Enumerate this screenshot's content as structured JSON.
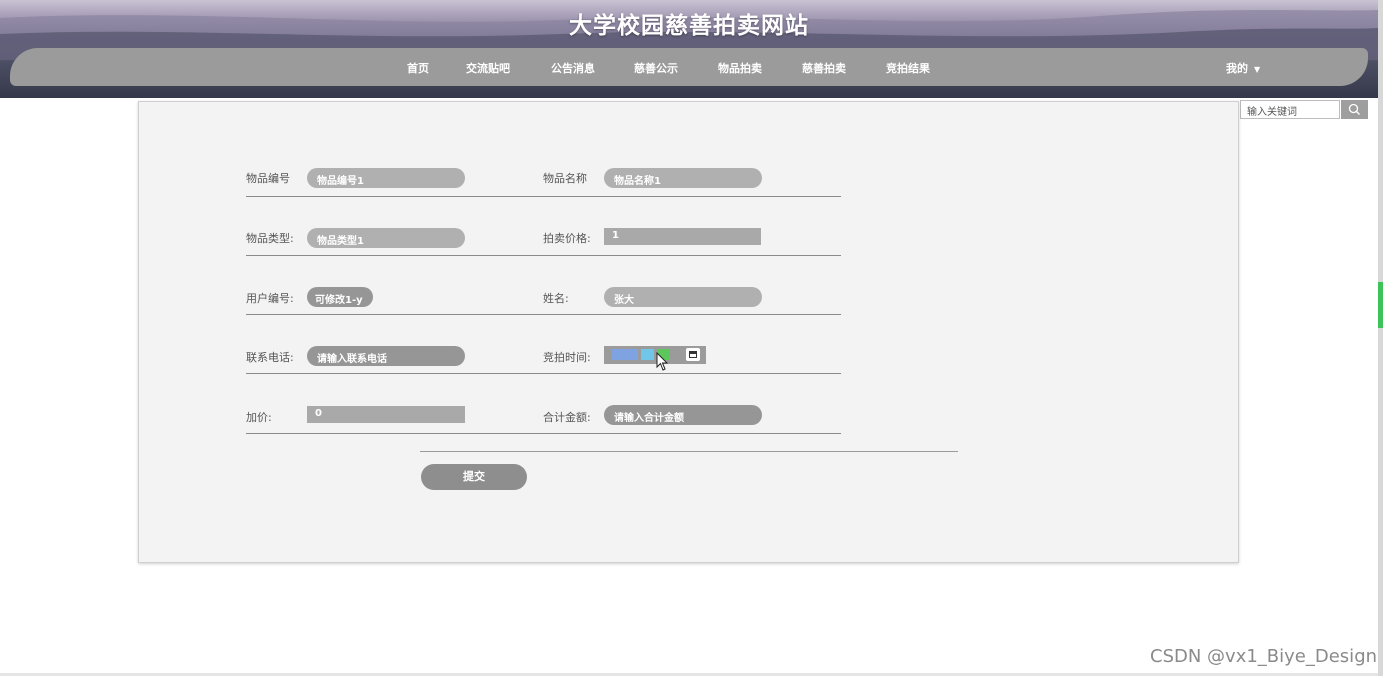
{
  "header": {
    "site_title": "大学校园慈善拍卖网站",
    "nav": [
      {
        "label": "首页"
      },
      {
        "label": "交流贴吧"
      },
      {
        "label": "公告消息"
      },
      {
        "label": "慈善公示"
      },
      {
        "label": "物品拍卖"
      },
      {
        "label": "慈善拍卖"
      },
      {
        "label": "竞拍结果"
      }
    ],
    "user_menu": "我的"
  },
  "search": {
    "placeholder": "输入关键词",
    "icon": "search-icon"
  },
  "form": {
    "item_code": {
      "label": "物品编号",
      "value": "物品编号1"
    },
    "item_name": {
      "label": "物品名称",
      "value": "物品名称1"
    },
    "item_type": {
      "label": "物品类型:",
      "value": "物品类型1"
    },
    "auction_price": {
      "label": "拍卖价格:",
      "value": "1"
    },
    "user_code": {
      "label": "用户编号:",
      "value": "可修改1-y"
    },
    "name": {
      "label": "姓名:",
      "value": "张大"
    },
    "phone": {
      "label": "联系电话:",
      "placeholder": "请输入联系电话"
    },
    "bid_time": {
      "label": "竞拍时间:",
      "icon": "calendar-icon"
    },
    "markup": {
      "label": "加价:",
      "value": "0"
    },
    "total": {
      "label": "合计金额:",
      "placeholder": "请输入合计金额"
    },
    "submit_label": "提交"
  },
  "watermark": "CSDN @vx1_Biye_Design",
  "colors": {
    "nav_bar": "#9b9b9b",
    "panel": "#f3f3f3",
    "field": "#b0b0b0",
    "button": "#8e8e8e"
  }
}
